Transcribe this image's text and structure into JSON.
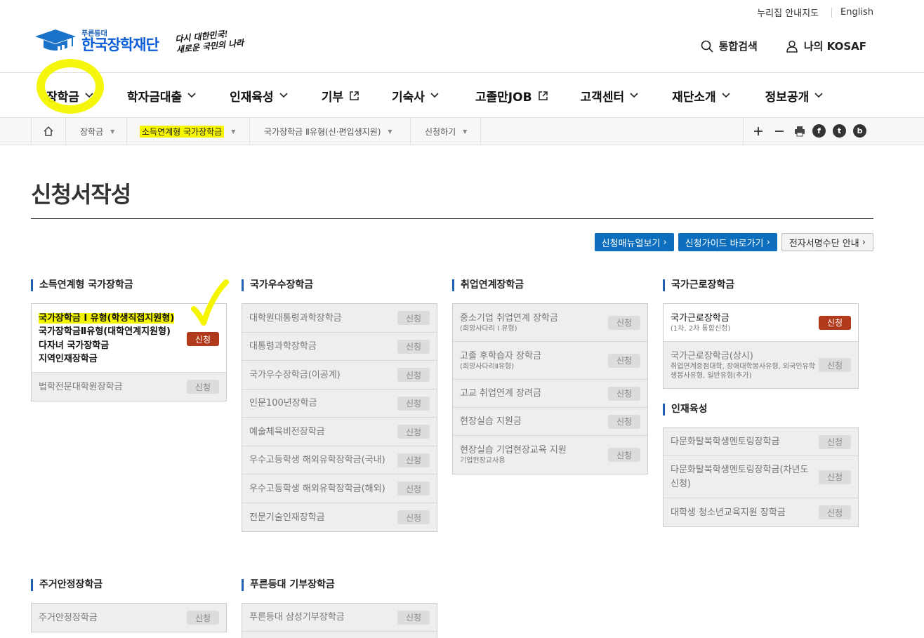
{
  "util": {
    "nuri": "누리집 안내지도",
    "english": "English"
  },
  "logo": {
    "small": "푸른등대",
    "big": "한국장학재단",
    "slogan1": "다시 대한민국!",
    "slogan2": "새로운 국민의 나라"
  },
  "header": {
    "search": "통합검색",
    "my": "나의 KOSAF"
  },
  "gnb": [
    "장학금",
    "학자금대출",
    "인재육성",
    "기부",
    "기숙사",
    "고졸만JOB",
    "고객센터",
    "재단소개",
    "정보공개"
  ],
  "breadcrumb": [
    "장학금",
    "소득연계형 국가장학금",
    "국가장학금 Ⅱ유형(신·편입생지원)",
    "신청하기"
  ],
  "page_title": "신청서작성",
  "buttons": {
    "manual": "신청매뉴얼보기",
    "guide": "신청가이드 바로가기",
    "esign": "전자서명수단 안내"
  },
  "apply_label": "신청",
  "col1": {
    "title": "소득연계형 국가장학금",
    "group": [
      "국가장학금 I 유형(학생직접지원형)",
      "국가장학금Ⅱ유형(대학연계지원형)",
      "다자녀 국가장학금",
      "지역인재장학금"
    ],
    "items": [
      "법학전문대학원장학금"
    ]
  },
  "col2": {
    "title": "국가우수장학금",
    "items": [
      "대학원대통령과학장학금",
      "대통령과학장학금",
      "국가우수장학금(이공계)",
      "인문100년장학금",
      "예술체육비전장학금",
      "우수고등학생 해외유학장학금(국내)",
      "우수고등학생 해외유학장학금(해외)",
      "전문기술인재장학금"
    ]
  },
  "col3": {
    "title": "취업연계장학금",
    "items": [
      {
        "label": "중소기업 취업연계 장학금",
        "sub": "(희망사다리 I 유형)"
      },
      {
        "label": "고졸 후학습자 장학금",
        "sub": "(희망사다리Ⅱ유형)"
      },
      {
        "label": "고교 취업연계 장려금",
        "sub": ""
      },
      {
        "label": "현장실습 지원금",
        "sub": ""
      },
      {
        "label": "현장실습 기업현장교육 지원",
        "sub": "기업현장교사용"
      }
    ]
  },
  "col4": {
    "title": "국가근로장학금",
    "items": [
      {
        "label": "국가근로장학금",
        "sub": "(1차, 2차 통합신청)"
      },
      {
        "label": "국가근로장학금(상시)",
        "sub": "취업연계중점대학, 장애대학봉사유형, 외국인유학생봉사유형, 일반유형(추가)"
      }
    ]
  },
  "col4b": {
    "title": "인재육성",
    "items": [
      "다문화탈북학생멘토링장학금",
      "다문화탈북학생멘토링장학금(차년도 신청)",
      "대학생 청소년교육지원 장학금"
    ]
  },
  "col5": {
    "title": "주거안정장학금",
    "items": [
      "주거안정장학금"
    ]
  },
  "col6": {
    "title": "푸른등대 기부장학금",
    "items": [
      "푸른등대 삼성기부장학금"
    ]
  },
  "colors": {
    "brand_blue": "#0d6ebd",
    "apply_red": "#b13a1c",
    "highlight_yellow": "#f6f500"
  }
}
